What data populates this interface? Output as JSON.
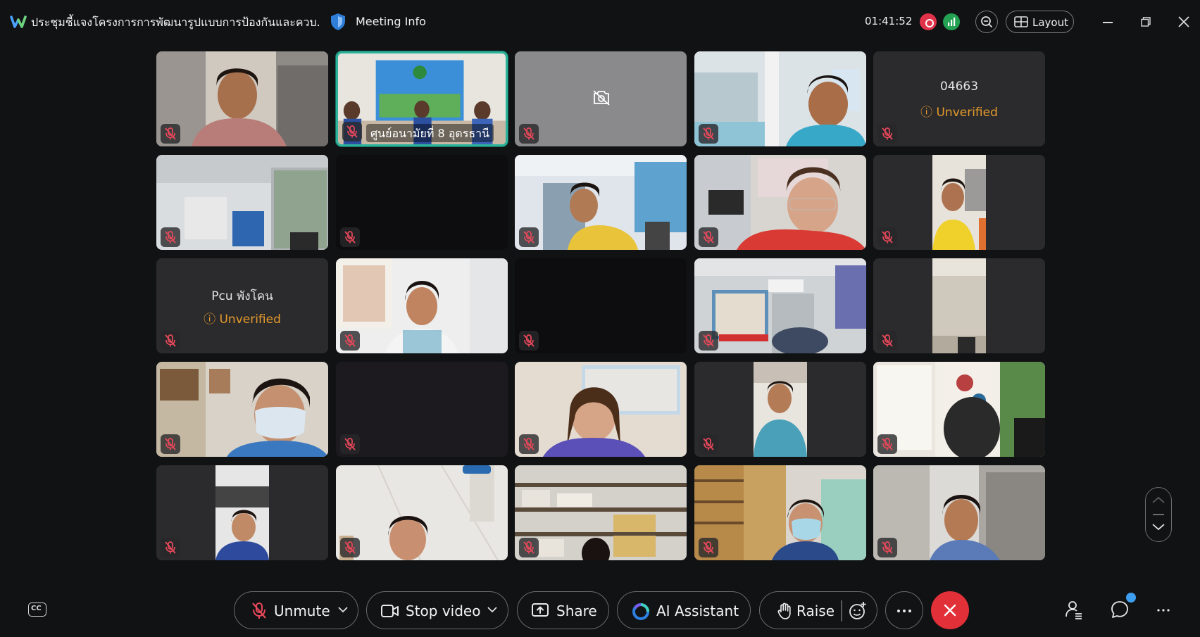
{
  "title_bar": {
    "meeting_title": "ประชุมชี้แจงโครงการการพัฒนารูปแบบการป้องกันและควบ...",
    "meeting_info_label": "Meeting Info",
    "timer": "01:41:52",
    "layout_label": "Layout"
  },
  "tiles": [
    {
      "kind": "video",
      "scene": "woman-curtain"
    },
    {
      "kind": "video",
      "scene": "conference-room",
      "label": "ศูนย์อนามัยที่ 8 อุดรธานี",
      "active": true
    },
    {
      "kind": "camera-off"
    },
    {
      "kind": "video",
      "scene": "man-office"
    },
    {
      "kind": "name",
      "name": "04663",
      "status": "Unverified"
    },
    {
      "kind": "video",
      "scene": "empty-office"
    },
    {
      "kind": "dark"
    },
    {
      "kind": "video",
      "scene": "woman-yellow"
    },
    {
      "kind": "video",
      "scene": "woman-red"
    },
    {
      "kind": "video",
      "scene": "woman-portrait"
    },
    {
      "kind": "name",
      "name": "Pcu พังโคน",
      "status": "Unverified"
    },
    {
      "kind": "video",
      "scene": "woman-white"
    },
    {
      "kind": "dark"
    },
    {
      "kind": "video",
      "scene": "office-board"
    },
    {
      "kind": "video",
      "scene": "ceiling-portrait"
    },
    {
      "kind": "video",
      "scene": "woman-mask"
    },
    {
      "kind": "dark2"
    },
    {
      "kind": "video",
      "scene": "woman-smile"
    },
    {
      "kind": "video",
      "scene": "woman-portrait-blue"
    },
    {
      "kind": "video",
      "scene": "posters"
    },
    {
      "kind": "video",
      "scene": "woman-portrait-navy"
    },
    {
      "kind": "video",
      "scene": "woman-ceiling"
    },
    {
      "kind": "video",
      "scene": "shelves"
    },
    {
      "kind": "video",
      "scene": "woman-mask-shelves"
    },
    {
      "kind": "video",
      "scene": "woman-curtain2"
    }
  ],
  "toolbar": {
    "unmute_label": "Unmute",
    "stop_video_label": "Stop video",
    "share_label": "Share",
    "ai_assistant_label": "AI Assistant",
    "raise_label": "Raise",
    "cc_label": "CC"
  },
  "colors": {
    "accent_active": "#2bb39b",
    "end_call": "#e13038",
    "unverified": "#e59a2c",
    "recording": "#e0334a"
  }
}
